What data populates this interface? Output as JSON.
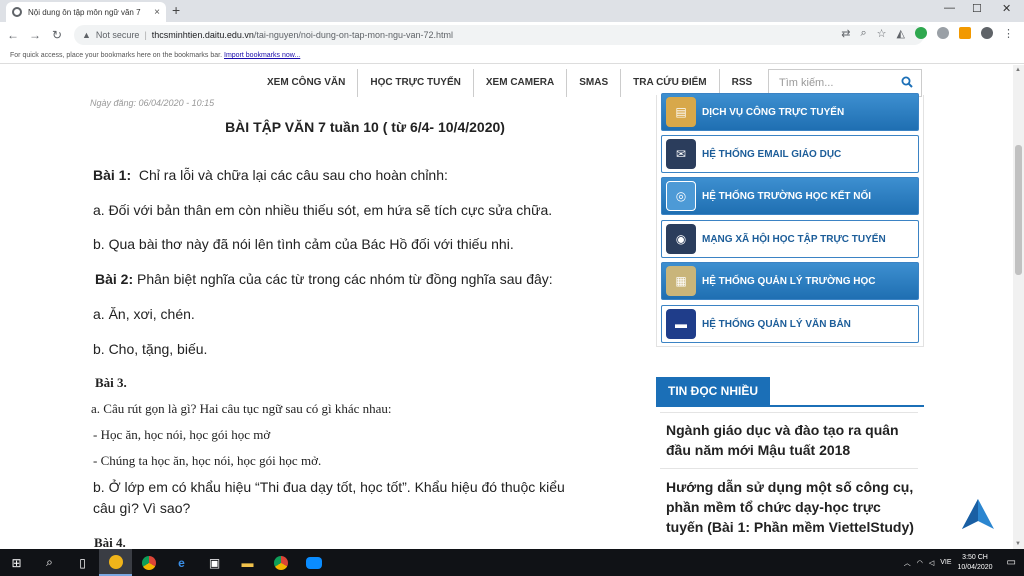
{
  "browser": {
    "tab_title": "Nội dung ôn tập môn ngữ văn 7",
    "tab_close": "×",
    "new_tab": "+",
    "window_min": "—",
    "window_max": "☐",
    "window_close": "✕",
    "security_label": "Not secure",
    "url_host": "thcsminhtien.daitu.edu.vn",
    "url_path": "/tai-nguyen/noi-dung-on-tap-mon-ngu-van-72.html",
    "bookmarks_text": "For quick access, place your bookmarks here on the bookmarks bar.",
    "bookmarks_link": "Import bookmarks now..."
  },
  "site": {
    "nav": [
      "XEM CÔNG VĂN",
      "HỌC TRỰC TUYẾN",
      "XEM CAMERA",
      "SMAS",
      "TRA CỨU ĐIỂM",
      "RSS"
    ],
    "search_placeholder": "Tìm kiếm..."
  },
  "article": {
    "date": "Ngày đăng: 06/04/2020 - 10:15",
    "title": "BÀI TẬP VĂN 7  tuần 10 ( từ  6/4- 10/4/2020)",
    "bai1_label": "Bài 1:",
    "bai1_text": "Chỉ ra lỗi và chữa lại các câu  sau cho hoàn chỉnh:",
    "bai1_a": "a. Đối với bản thân em còn nhiều thiếu sót, em hứa sẽ tích cực sửa chữa.",
    "bai1_b": "b. Qua bài thơ này đã nói lên tình cảm của Bác Hồ đối với thiếu nhi.",
    "bai2_label": "Bài 2:",
    "bai2_text": "Phân biệt nghĩa của các từ trong các nhóm từ đồng nghĩa sau đây:",
    "bai2_a": "a. Ăn, xơi, chén.",
    "bai2_b": "b. Cho, tặng, biếu.",
    "bai3_label": "Bài 3.",
    "bai3_a": "a. Câu rút gọn là gì? Hai câu tục ngữ sau có gì khác nhau:",
    "bai3_l1": "- Học ăn, học nói, học gói học mở",
    "bai3_l2": "- Chúng ta học ăn, học nói, học gói học mở.",
    "bai3_b1": "b. Ở lớp em có khẩu hiệu “Thi đua dạy tốt, học tốt”. Khẩu hiệu đó thuộc kiểu",
    "bai3_b2": "câu gì? Vì sao?",
    "bai4_label": "Bài 4."
  },
  "sidebar": {
    "services": [
      "DỊCH VỤ CÔNG TRỰC TUYẾN",
      "HỆ THỐNG EMAIL GIÁO DỤC",
      "HỆ THỐNG TRƯỜNG HỌC KẾT NỐI",
      "MẠNG XÃ HỘI HỌC TẬP TRỰC TUYẾN",
      "HỆ THỐNG QUẢN LÝ TRƯỜNG HỌC",
      "HỆ THỐNG QUẢN LÝ VĂN BẢN"
    ],
    "hot_title": "TIN ĐỌC NHIỀU",
    "hot_items": [
      "Ngành giáo dục và đào tạo ra quân đầu năm mới Mậu tuất 2018",
      "Hướng dẫn sử dụng một số công cụ, phần mềm tổ chức dạy-học trực tuyến (Bài 1: Phần mềm ViettelStudy)"
    ]
  },
  "taskbar": {
    "lang": "VIE",
    "time": "3:50 CH",
    "date": "10/04/2020"
  },
  "colors": {
    "accent": "#1b6fb7",
    "service_dark": "#2a7cc0"
  }
}
